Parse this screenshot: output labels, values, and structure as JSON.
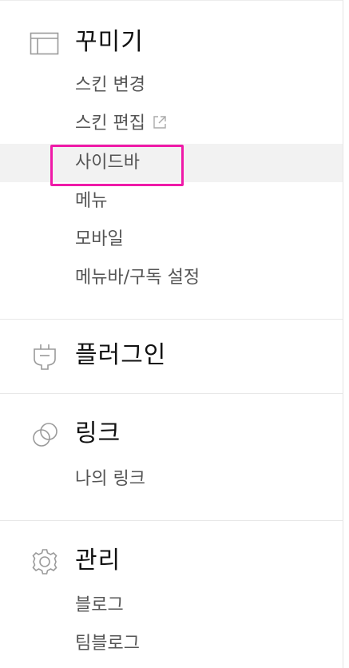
{
  "colors": {
    "highlight": "#ef1aa8",
    "active_bg": "#f2f2f2",
    "divider": "#e8e8e8"
  },
  "decorate": {
    "icon": "layout-icon",
    "title": "꾸미기",
    "items": [
      {
        "label": "스킨 변경"
      },
      {
        "label": "스킨 편집",
        "icon": "external-link-icon"
      },
      {
        "label": "사이드바",
        "active": true
      },
      {
        "label": "메뉴"
      },
      {
        "label": "모바일"
      },
      {
        "label": "메뉴바/구독 설정"
      }
    ]
  },
  "plugin": {
    "icon": "plug-icon",
    "title": "플러그인"
  },
  "link": {
    "icon": "link-icon",
    "title": "링크",
    "items": [
      {
        "label": "나의 링크"
      }
    ]
  },
  "manage": {
    "icon": "gear-icon",
    "title": "관리",
    "items": [
      {
        "label": "블로그"
      },
      {
        "label": "팀블로그"
      }
    ]
  }
}
